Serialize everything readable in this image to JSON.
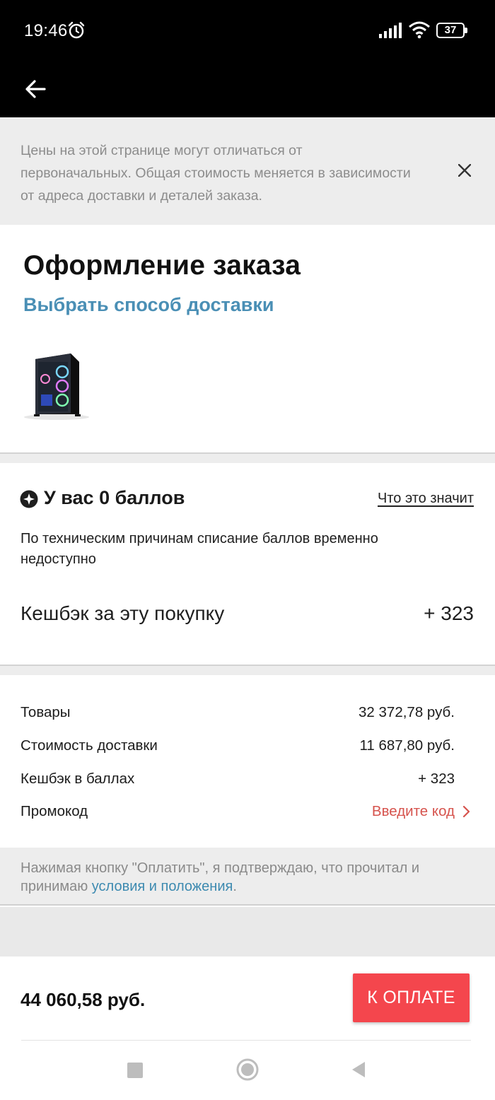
{
  "status_bar": {
    "time": "19:46",
    "battery": "37",
    "icons": [
      "alarm-icon",
      "signal-icon",
      "wifi-icon",
      "battery-icon"
    ]
  },
  "header": {
    "back_icon": "arrow-left-icon"
  },
  "notice": {
    "text": "Цены на этой странице могут отличаться от первоначальных. Общая стоимость меняется в зависимости от адреса доставки и деталей заказа.",
    "close_icon": "close-icon"
  },
  "checkout": {
    "title": "Оформление заказа",
    "delivery_link": "Выбрать способ доставки"
  },
  "points": {
    "title": "У вас 0 баллов",
    "link": "Что это значит",
    "note": "По техническим причинам списание баллов временно недоступно",
    "cashback_label": "Кешбэк за эту покупку",
    "cashback_value": "+ 323"
  },
  "summary": {
    "rows": [
      {
        "label": "Товары",
        "value": "32 372,78 руб."
      },
      {
        "label": "Стоимость доставки",
        "value": "11 687,80 руб."
      },
      {
        "label": "Кешбэк в баллах",
        "value": "+ 323"
      }
    ],
    "promo_label": "Промокод",
    "promo_link": "Введите код"
  },
  "terms": {
    "text": "Нажимая кнопку \"Оплатить\", я подтверждаю, что прочитал и принимаю ",
    "link": "условия и положения",
    "end": "."
  },
  "pay_bar": {
    "total": "44 060,58 руб.",
    "button": "К ОПЛАТЕ"
  },
  "colors": {
    "accent_link": "#4a8fb5",
    "pay_button": "#f4464d",
    "promo": "#d6534d"
  }
}
